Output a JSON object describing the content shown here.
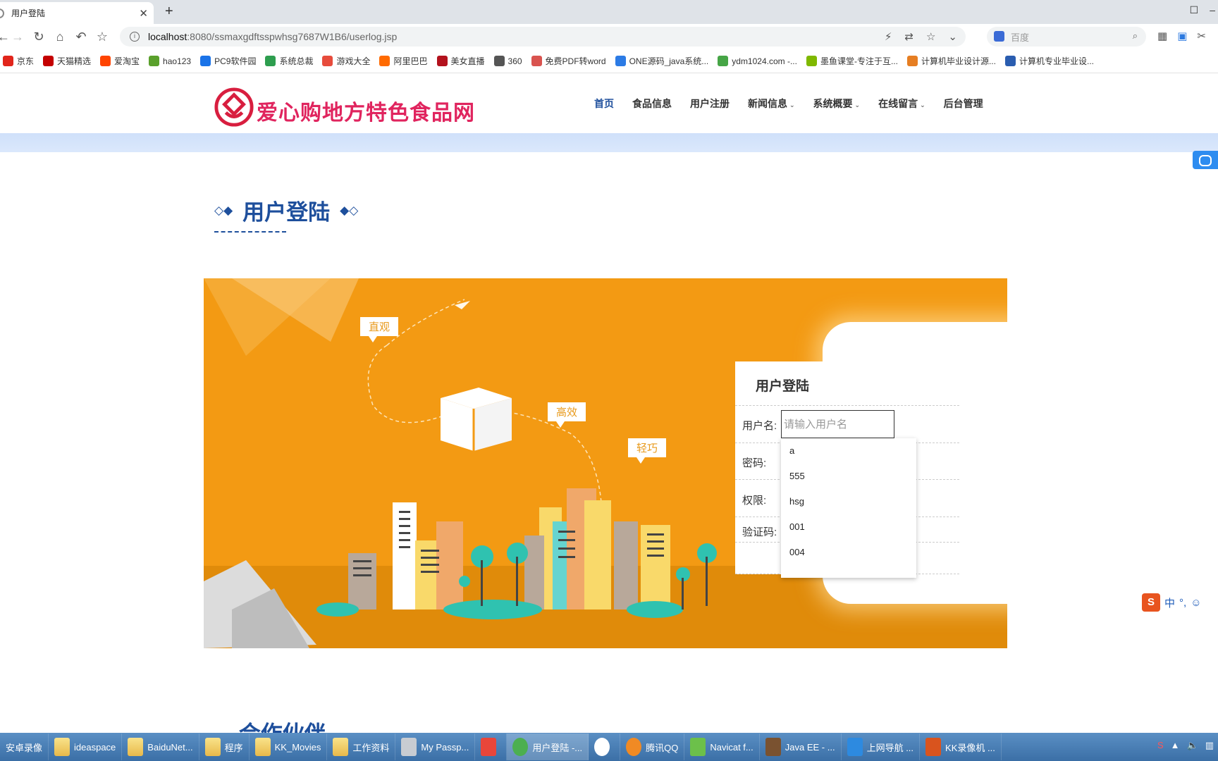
{
  "browser": {
    "tab_title": "用户登陆",
    "url_host": "localhost",
    "url_path": ":8080/ssmaxgdftsspwhsg7687W1B6/userlog.jsp",
    "search_placeholder": "百度"
  },
  "bookmarks": [
    {
      "label": "京东",
      "color": "#e1251b"
    },
    {
      "label": "天猫精选",
      "color": "#c40000"
    },
    {
      "label": "爱淘宝",
      "color": "#ff4400"
    },
    {
      "label": "hao123",
      "color": "#5aa02c"
    },
    {
      "label": "PC9软件园",
      "color": "#1a73e8"
    },
    {
      "label": "系统总裁",
      "color": "#2e9e4f"
    },
    {
      "label": "游戏大全",
      "color": "#e74c3c"
    },
    {
      "label": "阿里巴巴",
      "color": "#ff6a00"
    },
    {
      "label": "美女直播",
      "color": "#b3121d"
    },
    {
      "label": "360",
      "color": "#555555"
    },
    {
      "label": "免费PDF转word",
      "color": "#d9534f"
    },
    {
      "label": "ONE源码_java系统...",
      "color": "#2c7be5"
    },
    {
      "label": "ydm1024.com -...",
      "color": "#46a546"
    },
    {
      "label": "墨鱼课堂-专注于互...",
      "color": "#7fb800"
    },
    {
      "label": "计算机毕业设计源...",
      "color": "#e67e22"
    },
    {
      "label": "计算机专业毕业设...",
      "color": "#2a5db0"
    }
  ],
  "site": {
    "logo_text": "爱心购地方特色食品网",
    "brand_color": "#e0245e",
    "nav": [
      {
        "label": "首页",
        "active": true,
        "dropdown": false
      },
      {
        "label": "食品信息",
        "active": false,
        "dropdown": false
      },
      {
        "label": "用户注册",
        "active": false,
        "dropdown": false
      },
      {
        "label": "新闻信息",
        "active": false,
        "dropdown": true
      },
      {
        "label": "系统概要",
        "active": false,
        "dropdown": true
      },
      {
        "label": "在线留言",
        "active": false,
        "dropdown": true
      },
      {
        "label": "后台管理",
        "active": false,
        "dropdown": false
      }
    ]
  },
  "section": {
    "title": "用户登陆",
    "next_title": "合作伙伴"
  },
  "banner": {
    "tags": [
      "直观",
      "高效",
      "轻巧"
    ]
  },
  "login": {
    "title": "用户登陆",
    "username_label": "用户名:",
    "username_placeholder": "请输入用户名",
    "password_label": "密码:",
    "role_label": "权限:",
    "captcha_label": "验证码:",
    "autocomplete": [
      "a",
      "555",
      "hsg",
      "001",
      "004"
    ]
  },
  "ime": {
    "label": "中"
  },
  "taskbar": [
    {
      "label": "安卓录像",
      "icon": "none"
    },
    {
      "label": "ideaspace",
      "icon": "folder"
    },
    {
      "label": "BaiduNet...",
      "icon": "folder"
    },
    {
      "label": "程序",
      "icon": "folder"
    },
    {
      "label": "KK_Movies",
      "icon": "folder"
    },
    {
      "label": "工作资料",
      "icon": "folder"
    },
    {
      "label": "My Passp...",
      "icon": "drive"
    },
    {
      "label": "",
      "icon": "app"
    },
    {
      "label": "用户登陆 -...",
      "icon": "chrome",
      "active": true
    },
    {
      "label": "",
      "icon": "baidu"
    },
    {
      "label": "腾讯QQ",
      "icon": "speaker"
    },
    {
      "label": "Navicat f...",
      "icon": "navicat"
    },
    {
      "label": "Java EE - ...",
      "icon": "java"
    },
    {
      "label": "上网导航 ...",
      "icon": "ie"
    },
    {
      "label": "KK录像机 ...",
      "icon": "kk"
    }
  ]
}
